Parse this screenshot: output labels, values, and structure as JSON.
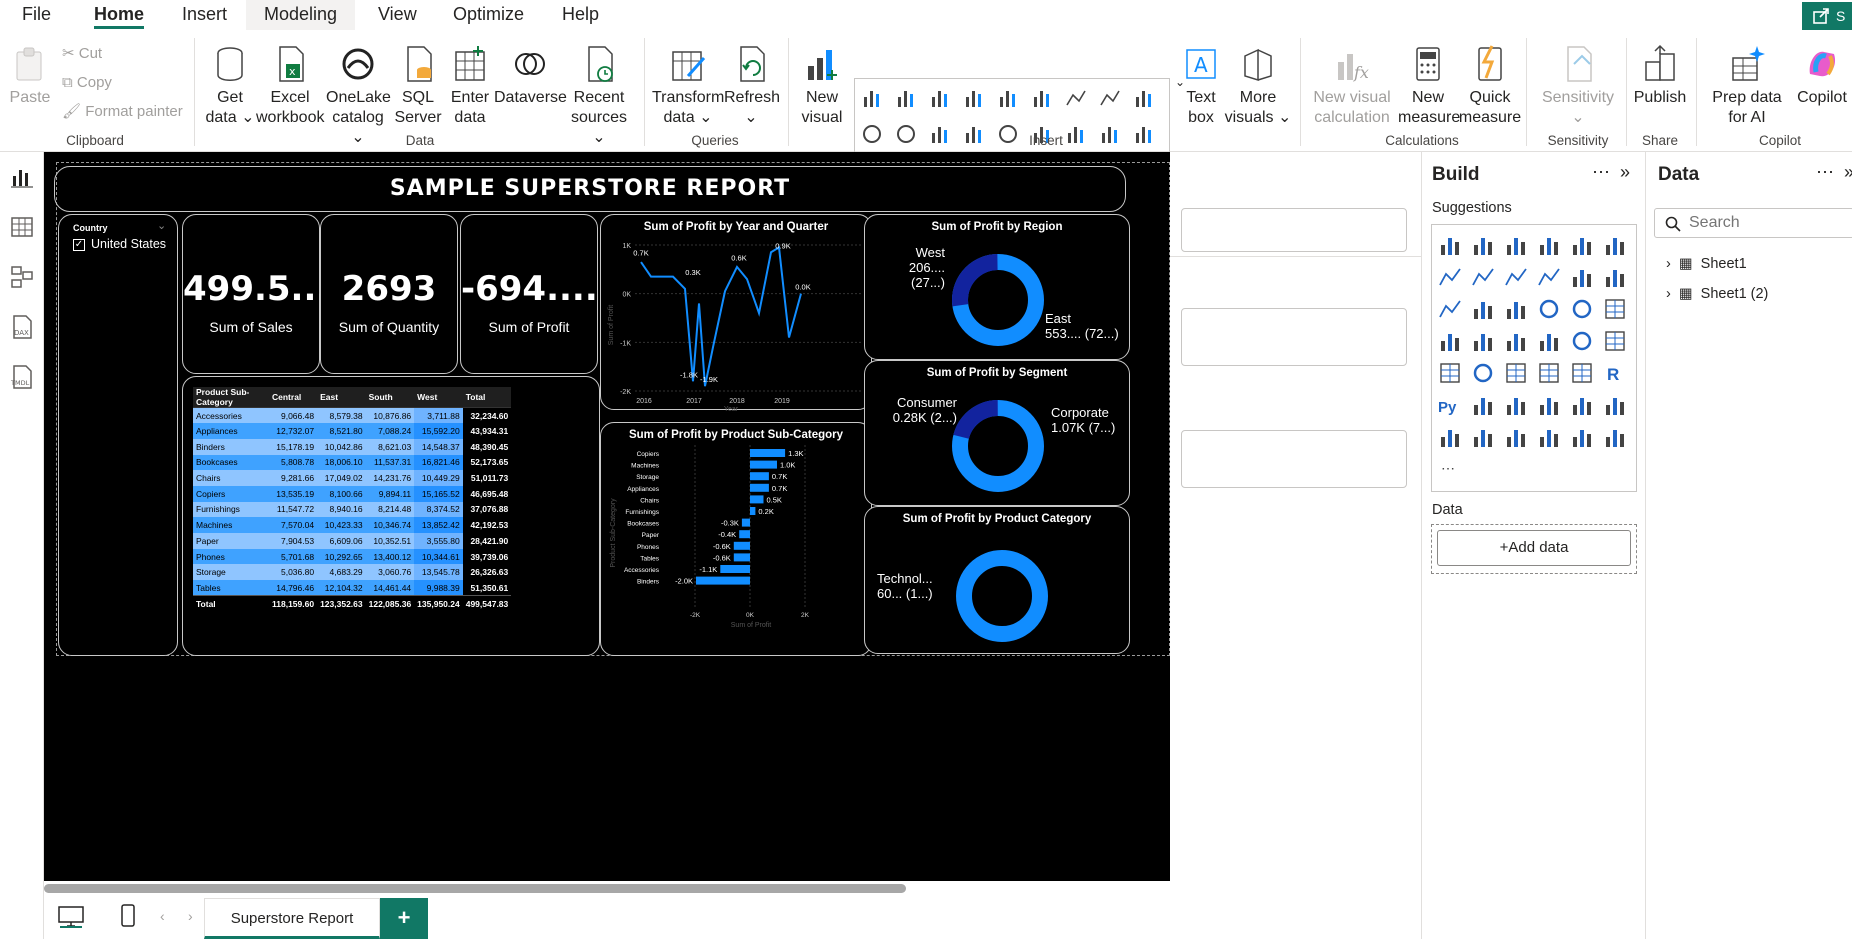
{
  "menu": {
    "file": "File",
    "home": "Home",
    "insert": "Insert",
    "modeling": "Modeling",
    "view": "View",
    "optimize": "Optimize",
    "help": "Help",
    "share": "S"
  },
  "ribbon": {
    "clipboard": {
      "paste": "Paste",
      "cut": "Cut",
      "copy": "Copy",
      "format_painter": "Format painter",
      "label": "Clipboard"
    },
    "data": {
      "get_data": "Get data",
      "excel": "Excel workbook",
      "onelake": "OneLake catalog",
      "sql": "SQL Server",
      "enter": "Enter data",
      "dataverse": "Dataverse",
      "recent": "Recent sources",
      "label": "Data"
    },
    "queries": {
      "transform": "Transform data",
      "refresh": "Refresh",
      "label": "Queries"
    },
    "insert": {
      "new_visual": "New visual",
      "text_box": "Text box",
      "more_visuals": "More visuals",
      "label": "Insert"
    },
    "calculations": {
      "new_visual_calc": "New visual calculation",
      "new_measure": "New measure",
      "quick_measure": "Quick measure",
      "label": "Calculations"
    },
    "sensitivity": {
      "sensitivity": "Sensitivity",
      "label": "Sensitivity"
    },
    "share": {
      "publish": "Publish",
      "label": "Share"
    },
    "copilot": {
      "prep": "Prep data for AI",
      "copilot": "Copilot",
      "label": "Copilot"
    }
  },
  "report": {
    "title": "SAMPLE SUPERSTORE REPORT",
    "slicer": {
      "title": "Country",
      "value": "United States"
    },
    "kpis": [
      {
        "value": "499.5...",
        "label": "Sum of Sales"
      },
      {
        "value": "2693",
        "label": "Sum of Quantity"
      },
      {
        "value": "-694....",
        "label": "Sum of Profit"
      }
    ],
    "matrix": {
      "headers": [
        "Product Sub-Category",
        "Central",
        "East",
        "South",
        "West",
        "Total"
      ],
      "rows": [
        [
          "Accessories",
          "9,066.48",
          "8,579.38",
          "10,876.86",
          "3,711.88",
          "32,234.60"
        ],
        [
          "Appliances",
          "12,732.07",
          "8,521.80",
          "7,088.24",
          "15,592.20",
          "43,934.31"
        ],
        [
          "Binders",
          "15,178.19",
          "10,042.86",
          "8,621.03",
          "14,548.37",
          "48,390.45"
        ],
        [
          "Bookcases",
          "5,808.78",
          "18,006.10",
          "11,537.31",
          "16,821.46",
          "52,173.65"
        ],
        [
          "Chairs",
          "9,281.66",
          "17,049.02",
          "14,231.76",
          "10,449.29",
          "51,011.73"
        ],
        [
          "Copiers",
          "13,535.19",
          "8,100.66",
          "9,894.11",
          "15,165.52",
          "46,695.48"
        ],
        [
          "Furnishings",
          "11,547.72",
          "8,940.16",
          "8,214.48",
          "8,374.52",
          "37,076.88"
        ],
        [
          "Machines",
          "7,570.04",
          "10,423.33",
          "10,346.74",
          "13,852.42",
          "42,192.53"
        ],
        [
          "Paper",
          "7,904.53",
          "6,609.06",
          "10,352.51",
          "3,555.80",
          "28,421.90"
        ],
        [
          "Phones",
          "5,701.68",
          "10,292.65",
          "13,400.12",
          "10,344.61",
          "39,739.06"
        ],
        [
          "Storage",
          "5,036.80",
          "4,683.29",
          "3,060.76",
          "13,545.78",
          "26,326.63"
        ],
        [
          "Tables",
          "14,796.46",
          "12,104.32",
          "14,461.44",
          "9,988.39",
          "51,350.61"
        ]
      ],
      "total": [
        "Total",
        "118,159.60",
        "123,352.63",
        "122,085.36",
        "135,950.24",
        "499,547.83"
      ]
    },
    "line": {
      "title": "Sum of Profit by Year and Quarter",
      "ylabel": "Sum of Profit",
      "xlabel": "Year",
      "yticks": [
        "1K",
        "0K",
        "-1K",
        "-2K"
      ],
      "xticks": [
        "2016",
        "2017",
        "2018",
        "2019"
      ],
      "labels": [
        "0.7K",
        "0.3K",
        "-1.8K",
        "-1.9K",
        "0.6K",
        "0.9K",
        "0.0K"
      ]
    },
    "bar": {
      "title": "Sum of Profit by Product Sub-Category",
      "ylabel": "Product Sub-Category",
      "xlabel": "Sum of Profit",
      "xticks": [
        "-2K",
        "0K",
        "2K"
      ],
      "categories": [
        "Copiers",
        "Machines",
        "Storage",
        "Appliances",
        "Chairs",
        "Furnishings",
        "Bookcases",
        "Paper",
        "Phones",
        "Tables",
        "Accessories",
        "Binders"
      ],
      "values": [
        1.3,
        1.0,
        0.7,
        0.7,
        0.5,
        0.2,
        -0.3,
        -0.4,
        -0.6,
        -0.6,
        -1.1,
        -2.0
      ],
      "labels": [
        "1.3K",
        "1.0K",
        "0.7K",
        "0.7K",
        "0.5K",
        "0.2K",
        "-0.3K",
        "-0.4K",
        "-0.6K",
        "-0.6K",
        "-1.1K",
        "-2.0K"
      ]
    },
    "donut_region": {
      "title": "Sum of Profit by Region",
      "west_a": "West",
      "west_b": "206.... (27...)",
      "east_a": "East",
      "east_b": "553.... (72...)",
      "share_small": 0.27
    },
    "donut_segment": {
      "title": "Sum of Profit by Segment",
      "cons_a": "Consumer",
      "cons_b": "0.28K (2...)",
      "corp_a": "Corporate",
      "corp_b": "1.07K (7...)",
      "share_small": 0.21
    },
    "donut_category": {
      "title": "Sum of Profit by Product Category",
      "tech_a": "Technol...",
      "tech_b": "60... (1...)"
    },
    "colors": {
      "accent": "#118dff",
      "dark": "#12239e",
      "canvas": "#000000"
    }
  },
  "build": {
    "title": "Build",
    "suggestions": "Suggestions",
    "data_label": "Data",
    "add_data": "+Add data"
  },
  "data_pane": {
    "title": "Data",
    "search_placeholder": "Search",
    "tables": [
      "Sheet1",
      "Sheet1 (2)"
    ]
  },
  "tabs": {
    "page": "Superstore Report",
    "add": "+"
  }
}
